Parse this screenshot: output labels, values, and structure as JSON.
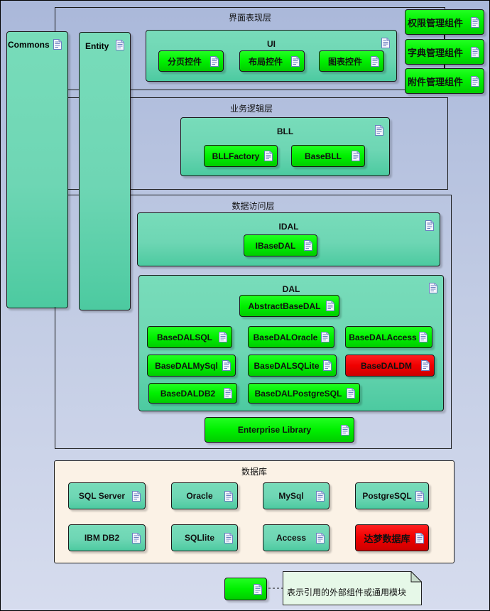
{
  "layers": {
    "presentation": {
      "title": "界面表现层"
    },
    "business": {
      "title": "业务逻辑层"
    },
    "data_access": {
      "title": "数据访问层"
    },
    "database": {
      "title": "数据库"
    }
  },
  "side_packages": {
    "commons": "Commons",
    "entity": "Entity"
  },
  "ui_package": {
    "title": "UI",
    "components": [
      "分页控件",
      "布局控件",
      "图表控件"
    ]
  },
  "right_components": [
    "权限管理组件",
    "字典管理组件",
    "附件管理组件"
  ],
  "bll_package": {
    "title": "BLL",
    "components": [
      "BLLFactory",
      "BaseBLL"
    ]
  },
  "idal_package": {
    "title": "IDAL",
    "components": [
      "IBaseDAL"
    ]
  },
  "dal_package": {
    "title": "DAL",
    "abstract": "AbstractBaseDAL",
    "components": [
      {
        "label": "BaseDALSQL",
        "status": "green"
      },
      {
        "label": "BaseDALOracle",
        "status": "green"
      },
      {
        "label": "BaseDALAccess",
        "status": "green"
      },
      {
        "label": "BaseDALMySql",
        "status": "green"
      },
      {
        "label": "BaseDALSQLite",
        "status": "green"
      },
      {
        "label": "BaseDALDM",
        "status": "red"
      },
      {
        "label": "BaseDALDB2",
        "status": "green"
      },
      {
        "label": "BaseDALPostgreSQL",
        "status": "green"
      }
    ]
  },
  "enterprise_library": "Enterprise Library",
  "databases": [
    {
      "label": "SQL Server",
      "status": "teal"
    },
    {
      "label": "Oracle",
      "status": "teal"
    },
    {
      "label": "MySql",
      "status": "teal"
    },
    {
      "label": "PostgreSQL",
      "status": "teal"
    },
    {
      "label": "IBM DB2",
      "status": "teal"
    },
    {
      "label": "SQLlite",
      "status": "teal"
    },
    {
      "label": "Access",
      "status": "teal"
    },
    {
      "label": "达梦数据库",
      "status": "red"
    }
  ],
  "legend": {
    "note": "表示引用的外部组件或通用模块"
  },
  "colors": {
    "component_green": "#00f000",
    "component_red": "#f00000",
    "package_teal": "#6ed6b4",
    "database_bg": "#fbf2e6",
    "note_bg": "#e6f8e8"
  }
}
